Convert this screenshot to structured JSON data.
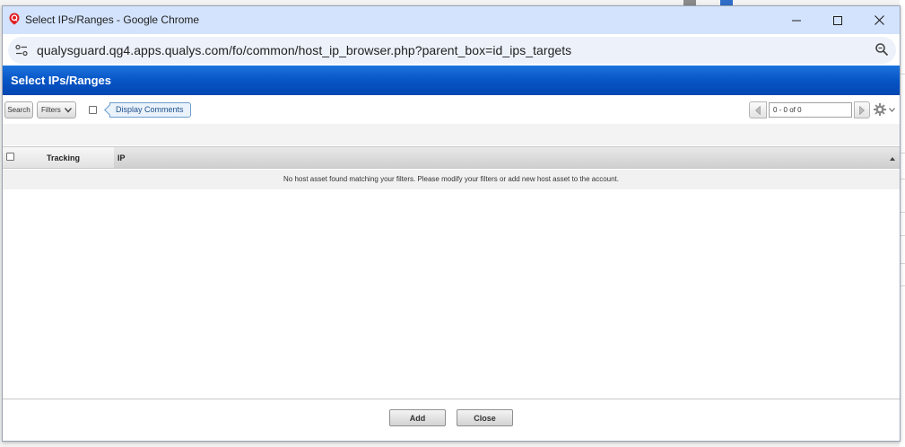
{
  "window": {
    "title": "Select IPs/Ranges - Google Chrome",
    "url": "qualysguard.qg4.apps.qualys.com/fo/common/host_ip_browser.php?parent_box=id_ips_targets"
  },
  "dialog": {
    "header_title": "Select IPs/Ranges"
  },
  "toolbar": {
    "search_label": "Search",
    "filters_label": "Filters",
    "display_comments_label": "Display Comments",
    "pager_text": "0 - 0 of 0"
  },
  "table": {
    "columns": [
      "Tracking",
      "IP"
    ],
    "empty_message": "No host asset found matching your filters. Please modify your filters or add new host asset to the account."
  },
  "footer": {
    "add_label": "Add",
    "close_label": "Close"
  },
  "colors": {
    "header_blue": "#0653c4",
    "titlebar": "#d3e3fd",
    "urlbar": "#edf2fa"
  }
}
